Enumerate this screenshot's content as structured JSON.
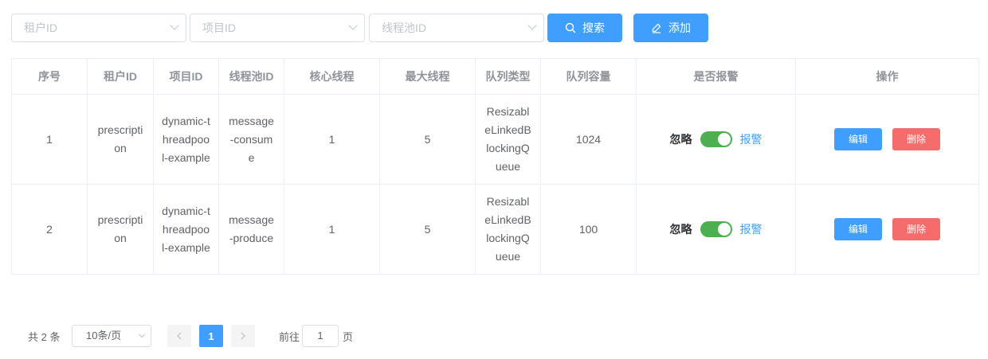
{
  "filters": {
    "tenant_placeholder": "租户ID",
    "project_placeholder": "项目ID",
    "pool_placeholder": "线程池ID"
  },
  "toolbar": {
    "search_label": "搜索",
    "add_label": "添加"
  },
  "table": {
    "headers": [
      "序号",
      "租户ID",
      "项目ID",
      "线程池ID",
      "核心线程",
      "最大线程",
      "队列类型",
      "队列容量",
      "是否报警",
      "操作"
    ],
    "rows": [
      {
        "index": "1",
        "tenant": "prescription",
        "project": "dynamic-threadpool-example",
        "pool": "message-consume",
        "core": "1",
        "max": "5",
        "queue_type": "ResizableLinkedBlockingQueue",
        "capacity": "1024",
        "alarm_enabled": true
      },
      {
        "index": "2",
        "tenant": "prescription",
        "project": "dynamic-threadpool-example",
        "pool": "message-produce",
        "core": "1",
        "max": "5",
        "queue_type": "ResizableLinkedBlockingQueue",
        "capacity": "100",
        "alarm_enabled": true
      }
    ],
    "alarm_off_label": "忽略",
    "alarm_on_label": "报警",
    "edit_label": "编辑",
    "delete_label": "删除"
  },
  "pagination": {
    "total_text": "共 2 条",
    "page_size": "10条/页",
    "current_page": "1",
    "goto_prefix": "前往",
    "goto_value": "1",
    "goto_suffix": "页"
  },
  "colors": {
    "primary": "#409eff",
    "danger": "#f56c6c",
    "switch_on": "#4caf50"
  }
}
